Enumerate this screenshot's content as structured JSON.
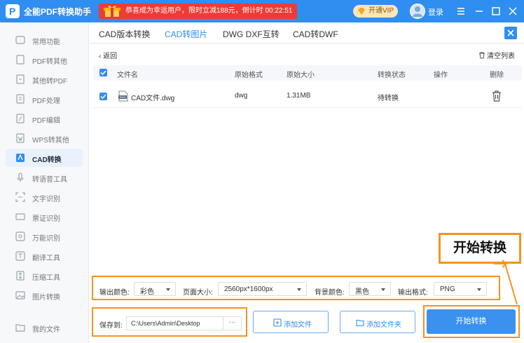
{
  "app": {
    "title": "全能PDF转换助手",
    "promo_text": "恭喜成为幸运用户，限时立减188元，倒计时 00:22:51",
    "vip_label": "开通VIP",
    "login_label": "登录"
  },
  "sidebar": {
    "items": [
      {
        "label": "常用功能",
        "icon": "star-icon"
      },
      {
        "label": "PDF转其他",
        "icon": "pdf-convert-icon"
      },
      {
        "label": "其他转PDF",
        "icon": "to-pdf-icon"
      },
      {
        "label": "PDF处理",
        "icon": "pdf-process-icon"
      },
      {
        "label": "PDF编辑",
        "icon": "pdf-edit-icon"
      },
      {
        "label": "WPS转其他",
        "icon": "wps-icon"
      },
      {
        "label": "CAD转换",
        "icon": "cad-icon",
        "active": true
      },
      {
        "label": "转语音工具",
        "icon": "voice-icon"
      },
      {
        "label": "文字识别",
        "icon": "ocr-icon"
      },
      {
        "label": "票证识别",
        "icon": "ticket-icon"
      },
      {
        "label": "万能识别",
        "icon": "scan-icon"
      },
      {
        "label": "翻译工具",
        "icon": "translate-icon"
      },
      {
        "label": "压缩工具",
        "icon": "compress-icon"
      },
      {
        "label": "图片转换",
        "icon": "image-icon"
      }
    ],
    "my_files": "我的文件"
  },
  "tabs": [
    {
      "label": "CAD版本转换"
    },
    {
      "label": "CAD转图片",
      "active": true
    },
    {
      "label": "DWG DXF互转"
    },
    {
      "label": "CAD转DWF"
    }
  ],
  "toolbar": {
    "back_label": "返回",
    "clear_label": "清空列表"
  },
  "table": {
    "headers": [
      "文件名",
      "原始格式",
      "原始大小",
      "转换状态",
      "操作",
      "删除"
    ],
    "rows": [
      {
        "name": "CAD文件.dwg",
        "format": "dwg",
        "size": "1.31MB",
        "status": "待转换",
        "icon_tag": "DWG"
      }
    ]
  },
  "options": {
    "color_label": "输出颜色:",
    "color_value": "彩色",
    "page_size_label": "页面大小:",
    "page_size_value": "2560px*1600px",
    "bg_label": "背景颜色:",
    "bg_value": "黑色",
    "format_label": "输出格式:",
    "format_value": "PNG"
  },
  "footer": {
    "save_label": "保存到:",
    "save_path": "C:\\Users\\Admin\\Desktop",
    "more": "···",
    "add_file": "添加文件",
    "add_folder": "添加文件夹",
    "start": "开始转换"
  },
  "callout": {
    "text": "开始转换"
  },
  "colors": {
    "brand_blue": "#2f8ef0",
    "highlight_orange": "#f7931e",
    "promo_red": "#ef3b34"
  }
}
